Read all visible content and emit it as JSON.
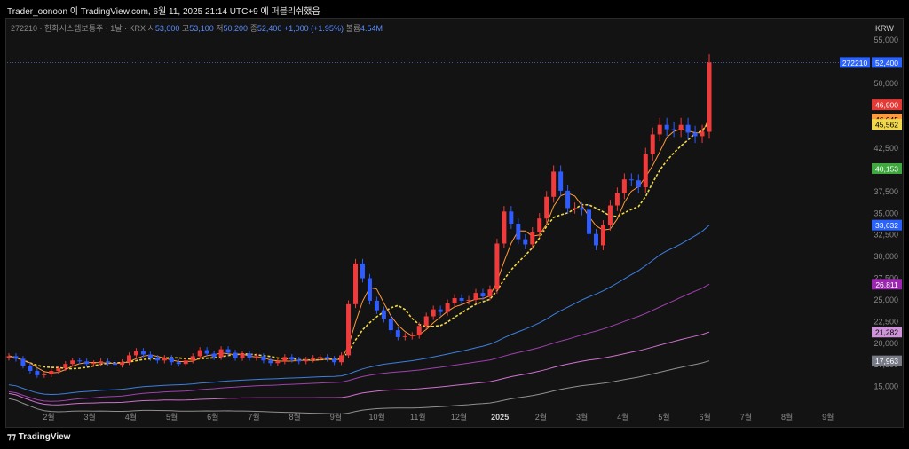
{
  "header": {
    "attribution": "Trader_oonoon 이 TradingView.com, 6월 11, 2025 21:14 UTC+9 에 퍼블리쉬했음"
  },
  "legend": {
    "symbol_line": "272210 · 한화시스템보통주 · 1날 · KRX",
    "o_label": "시",
    "o_value": "53,000",
    "h_label": "고",
    "h_value": "53,100",
    "l_label": "저",
    "l_value": "50,200",
    "c_label": "종",
    "c_value": "52,400",
    "change": "+1,000 (+1.95%)",
    "vol_label": "볼륨",
    "vol_value": "4.54M"
  },
  "currency": "KRW",
  "footer": {
    "brand": "TradingView"
  },
  "colors": {
    "background": "#131313",
    "up_candle": "#ef3b3b",
    "down_candle": "#2e5cff",
    "ema_short": "#ff9a3c",
    "ema_yellow": "#f0d84a",
    "ema_green": "#3fbf3f",
    "ma_blue": "#3d7fe0",
    "ma_purple": "#a040b0",
    "ma_pink": "#d070d0",
    "ma_gray": "#909090"
  },
  "chart_data": {
    "type": "candlestick",
    "y_axis": {
      "min": 12500,
      "max": 55000,
      "ticks": [
        15000,
        17500,
        20000,
        22500,
        25000,
        27500,
        30000,
        32500,
        35000,
        37500,
        40000,
        42500,
        45000,
        47500,
        50000,
        52500,
        55000
      ],
      "tick_labels": [
        "15,000",
        "17,500",
        "20,000",
        "22,500",
        "25,000",
        "27,500",
        "30,000",
        "32,500",
        "35,000",
        "37,500",
        "40,000",
        "42,500",
        "45,000",
        "47,500",
        "50,000",
        "52,500",
        "55,000"
      ]
    },
    "x_axis": {
      "labels": [
        "2월",
        "3월",
        "4월",
        "5월",
        "6월",
        "7월",
        "8월",
        "9월",
        "10월",
        "11월",
        "12월",
        "2025",
        "2월",
        "3월",
        "4월",
        "5월",
        "6월",
        "7월",
        "8월",
        "9월"
      ]
    },
    "price_labels": [
      {
        "text": "272210",
        "value": 52400,
        "color": "#2962ff"
      },
      {
        "text": "52,400",
        "value": 52400,
        "color": "#2962ff"
      },
      {
        "text": "46,900",
        "value": 46900,
        "color": "#e53935"
      },
      {
        "text": "46,045",
        "value": 46045,
        "color": "#ff9a3c"
      },
      {
        "text": "45,562",
        "value": 45562,
        "color": "#f0d84a"
      },
      {
        "text": "40,153",
        "value": 40153,
        "color": "#3fa83f"
      },
      {
        "text": "33,632",
        "value": 33632,
        "color": "#2962ff"
      },
      {
        "text": "26,811",
        "value": 26811,
        "color": "#9c27b0"
      },
      {
        "text": "21,282",
        "value": 21282,
        "color": "#ce93d8"
      },
      {
        "text": "17,963",
        "value": 17963,
        "color": "#787b86"
      }
    ],
    "close_path": [
      18500,
      18200,
      17400,
      16800,
      16300,
      16400,
      16800,
      17100,
      17600,
      18000,
      17900,
      17600,
      17700,
      17900,
      17700,
      17500,
      17800,
      18600,
      19100,
      18700,
      18300,
      18000,
      18300,
      17800,
      17600,
      18000,
      18500,
      19200,
      18800,
      18400,
      19300,
      18900,
      18300,
      18800,
      18300,
      18500,
      18000,
      17700,
      17900,
      18400,
      18100,
      17900,
      18100,
      18300,
      18400,
      18200,
      17800,
      18600,
      24500,
      29200,
      27500,
      24900,
      23800,
      22800,
      21500,
      20700,
      20800,
      20900,
      22000,
      23100,
      23900,
      23600,
      24600,
      25200,
      24900,
      25000,
      25800,
      25400,
      26200,
      31500,
      35200,
      33800,
      32000,
      31400,
      32800,
      34400,
      36900,
      39800,
      37600,
      35600,
      35600,
      35400,
      32600,
      31300,
      33600,
      35900,
      37300,
      38900,
      38800,
      38000,
      41800,
      44100,
      45200,
      44700,
      44600,
      45200,
      44300,
      43900,
      44400,
      52400
    ],
    "moving_averages": {
      "ema_short_end": 46045,
      "ema_yellow_end": 45562,
      "ema_green_end": 40153,
      "ma_blue_end": 33632,
      "ma_purple_end": 26811,
      "ma_pink_end": 21282,
      "ma_gray_end": 17963
    }
  }
}
